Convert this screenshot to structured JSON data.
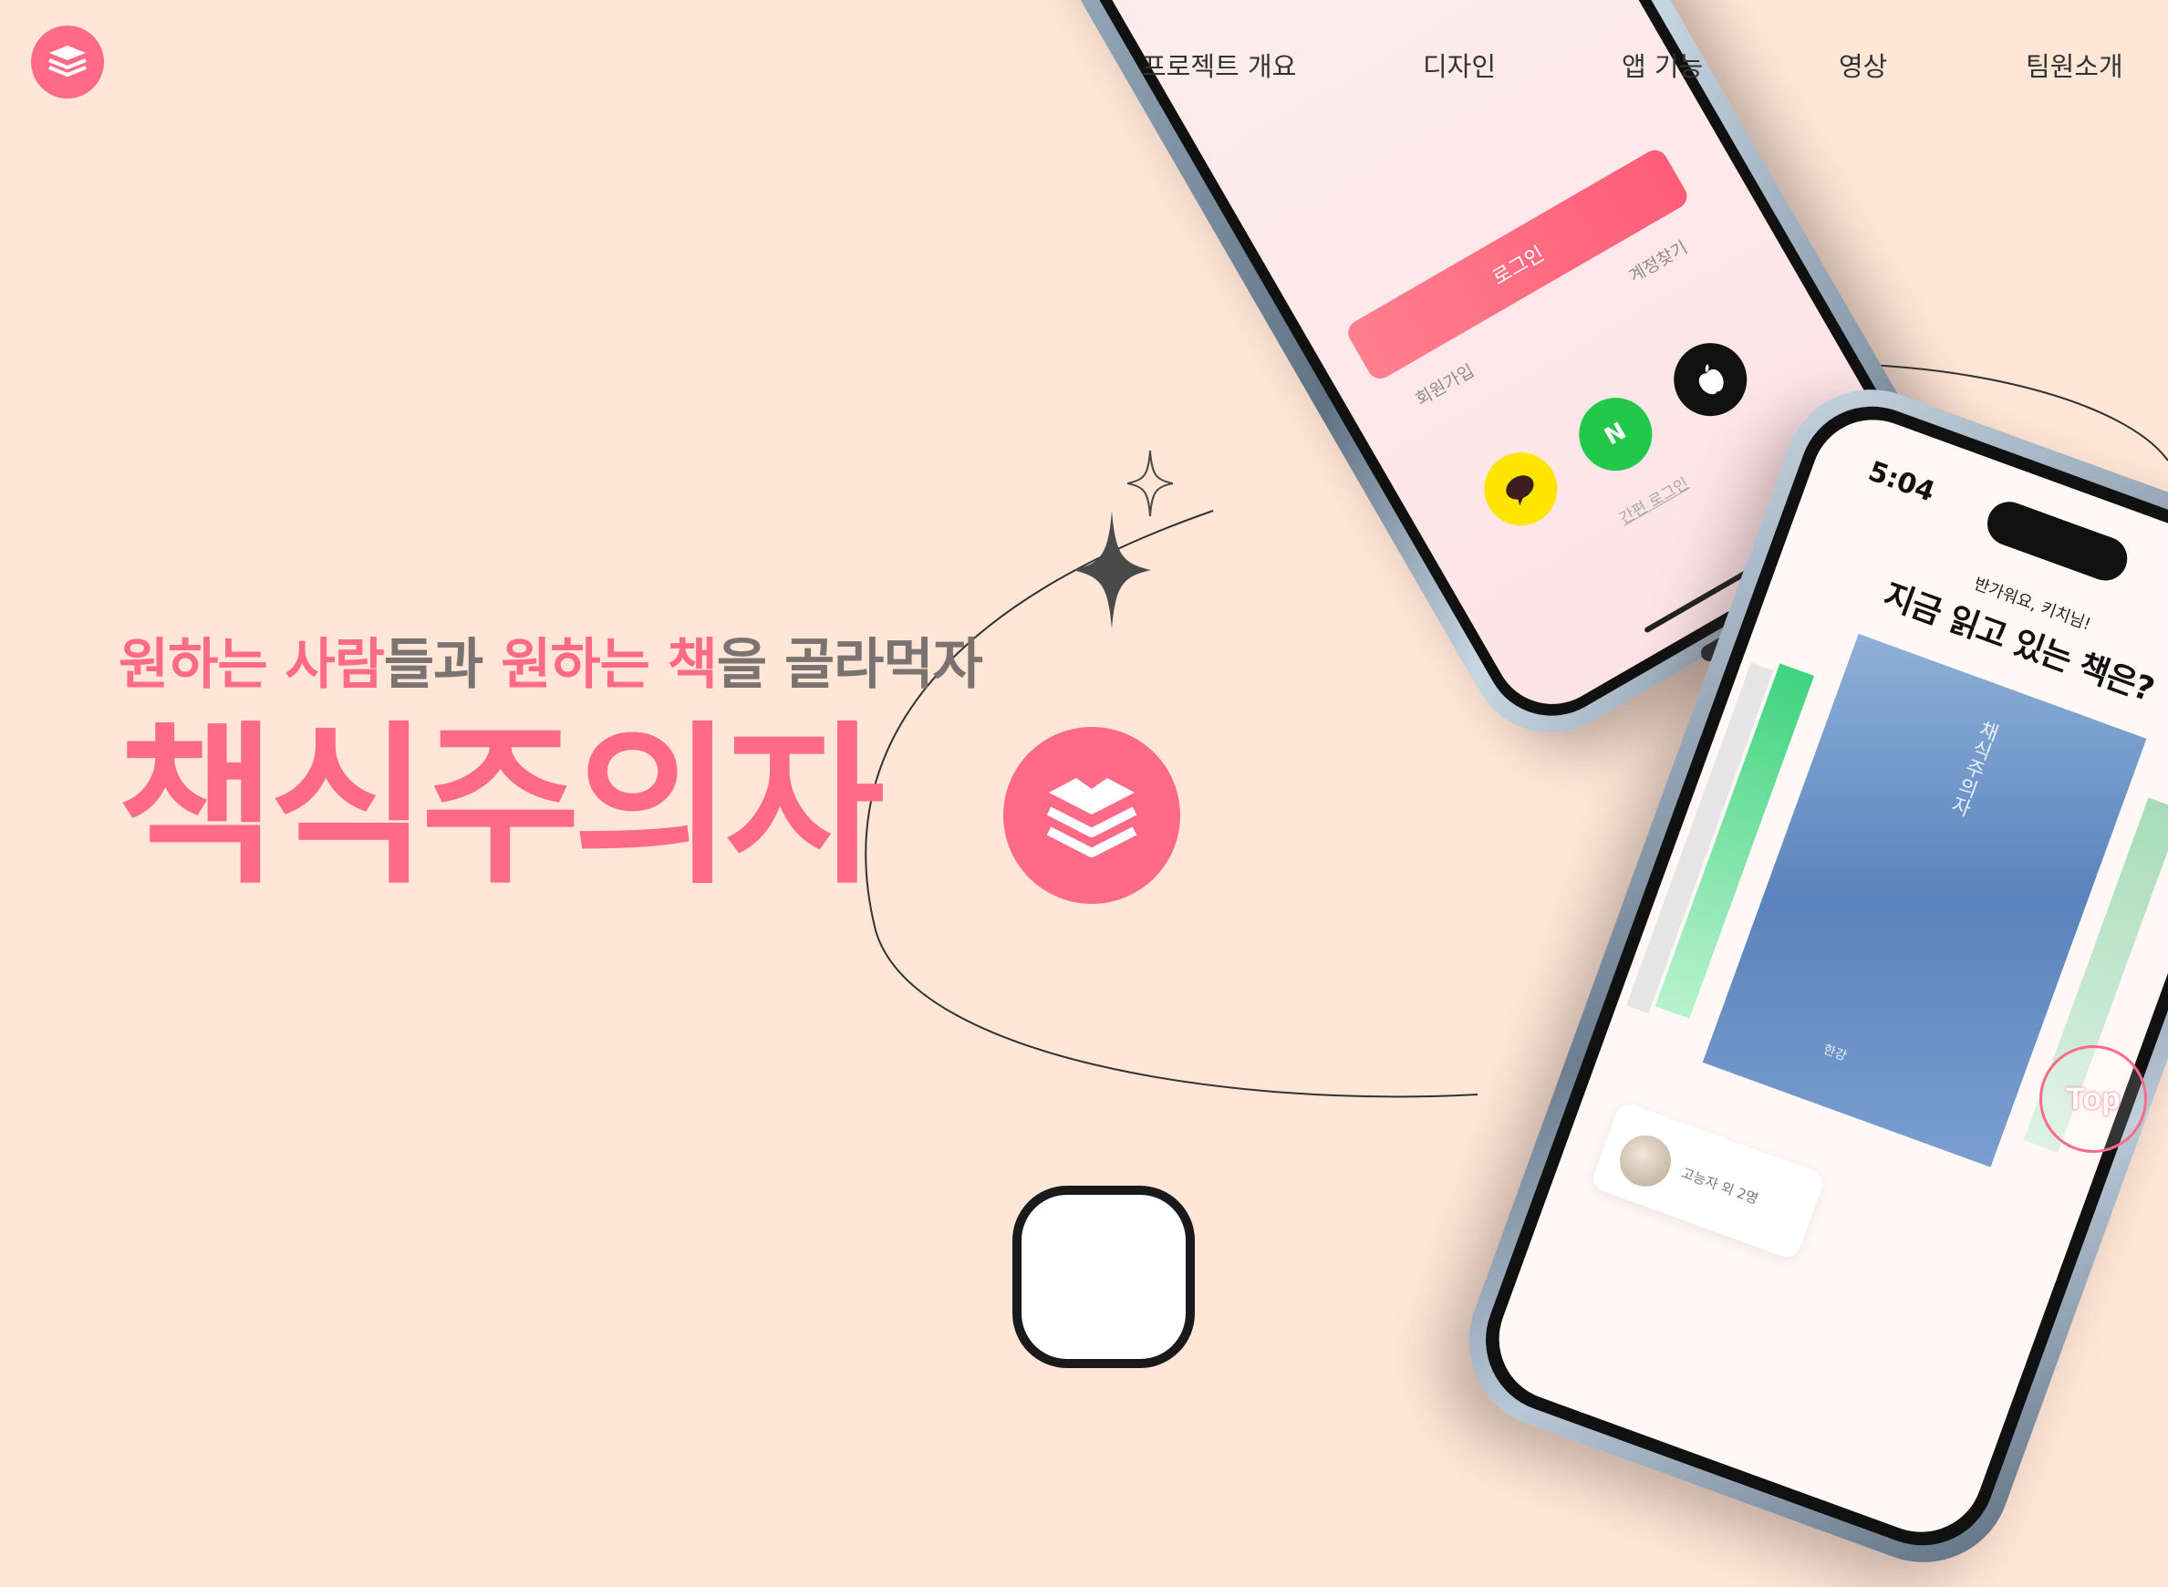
{
  "nav": {
    "items": [
      {
        "label": "프로젝트 개요"
      },
      {
        "label": "디자인"
      },
      {
        "label": "앱 기능"
      },
      {
        "label": "영상"
      },
      {
        "label": "팀원소개"
      }
    ]
  },
  "hero": {
    "subtitle_parts": {
      "p1": "원하는 사람",
      "p2": "들과 ",
      "p3": "원하는 책",
      "p4": "을 골라먹자"
    },
    "title": "책식주의자"
  },
  "phone_login": {
    "login_button": "로그인",
    "signup_link": "회원가입",
    "find_account_link": "계정찾기",
    "naver_letter": "N",
    "easy_login": "간편 로그인"
  },
  "phone_home": {
    "time": "5:04",
    "greeting": "반가워요, 키치님!",
    "question": "지금 읽고 있는 책은?",
    "book_title": "채식주의자",
    "book_author": "한강",
    "card_label": "고능자 외 2명"
  },
  "top_button": {
    "label": "Top"
  },
  "colors": {
    "background": "#ffe6d6",
    "accent": "#ff6b86",
    "text_gray": "#7a7371"
  }
}
